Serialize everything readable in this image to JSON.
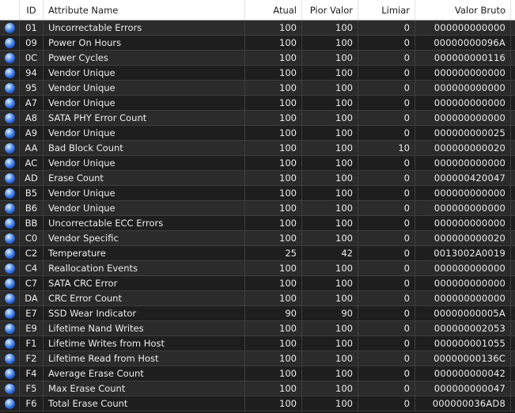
{
  "headers": {
    "id": "ID",
    "name": "Attribute Name",
    "current": "Atual",
    "worst": "Pior Valor",
    "threshold": "Limiar",
    "raw": "Valor Bruto"
  },
  "status_color": "#3a78e0",
  "rows": [
    {
      "id": "01",
      "name": "Uncorrectable Errors",
      "current": "100",
      "worst": "100",
      "threshold": "0",
      "raw": "000000000000"
    },
    {
      "id": "09",
      "name": "Power On Hours",
      "current": "100",
      "worst": "100",
      "threshold": "0",
      "raw": "00000000096A"
    },
    {
      "id": "0C",
      "name": "Power Cycles",
      "current": "100",
      "worst": "100",
      "threshold": "0",
      "raw": "000000000116"
    },
    {
      "id": "94",
      "name": "Vendor Unique",
      "current": "100",
      "worst": "100",
      "threshold": "0",
      "raw": "000000000000"
    },
    {
      "id": "95",
      "name": "Vendor Unique",
      "current": "100",
      "worst": "100",
      "threshold": "0",
      "raw": "000000000000"
    },
    {
      "id": "A7",
      "name": "Vendor Unique",
      "current": "100",
      "worst": "100",
      "threshold": "0",
      "raw": "000000000000"
    },
    {
      "id": "A8",
      "name": "SATA PHY Error Count",
      "current": "100",
      "worst": "100",
      "threshold": "0",
      "raw": "000000000000"
    },
    {
      "id": "A9",
      "name": "Vendor Unique",
      "current": "100",
      "worst": "100",
      "threshold": "0",
      "raw": "000000000025"
    },
    {
      "id": "AA",
      "name": "Bad Block Count",
      "current": "100",
      "worst": "100",
      "threshold": "10",
      "raw": "000000000020"
    },
    {
      "id": "AC",
      "name": "Vendor Unique",
      "current": "100",
      "worst": "100",
      "threshold": "0",
      "raw": "000000000000"
    },
    {
      "id": "AD",
      "name": "Erase Count",
      "current": "100",
      "worst": "100",
      "threshold": "0",
      "raw": "000000420047"
    },
    {
      "id": "B5",
      "name": "Vendor Unique",
      "current": "100",
      "worst": "100",
      "threshold": "0",
      "raw": "000000000000"
    },
    {
      "id": "B6",
      "name": "Vendor Unique",
      "current": "100",
      "worst": "100",
      "threshold": "0",
      "raw": "000000000000"
    },
    {
      "id": "BB",
      "name": "Uncorrectable ECC Errors",
      "current": "100",
      "worst": "100",
      "threshold": "0",
      "raw": "000000000000"
    },
    {
      "id": "C0",
      "name": "Vendor Specific",
      "current": "100",
      "worst": "100",
      "threshold": "0",
      "raw": "000000000020"
    },
    {
      "id": "C2",
      "name": "Temperature",
      "current": "25",
      "worst": "42",
      "threshold": "0",
      "raw": "0013002A0019"
    },
    {
      "id": "C4",
      "name": "Reallocation Events",
      "current": "100",
      "worst": "100",
      "threshold": "0",
      "raw": "000000000000"
    },
    {
      "id": "C7",
      "name": "SATA CRC Error",
      "current": "100",
      "worst": "100",
      "threshold": "0",
      "raw": "000000000000"
    },
    {
      "id": "DA",
      "name": "CRC Error Count",
      "current": "100",
      "worst": "100",
      "threshold": "0",
      "raw": "000000000000"
    },
    {
      "id": "E7",
      "name": "SSD Wear Indicator",
      "current": "90",
      "worst": "90",
      "threshold": "0",
      "raw": "00000000005A"
    },
    {
      "id": "E9",
      "name": "Lifetime Nand Writes",
      "current": "100",
      "worst": "100",
      "threshold": "0",
      "raw": "000000002053"
    },
    {
      "id": "F1",
      "name": "Lifetime Writes from Host",
      "current": "100",
      "worst": "100",
      "threshold": "0",
      "raw": "000000001055"
    },
    {
      "id": "F2",
      "name": "Lifetime Read from Host",
      "current": "100",
      "worst": "100",
      "threshold": "0",
      "raw": "00000000136C"
    },
    {
      "id": "F4",
      "name": "Average Erase Count",
      "current": "100",
      "worst": "100",
      "threshold": "0",
      "raw": "000000000042"
    },
    {
      "id": "F5",
      "name": "Max Erase Count",
      "current": "100",
      "worst": "100",
      "threshold": "0",
      "raw": "000000000047"
    },
    {
      "id": "F6",
      "name": "Total Erase Count",
      "current": "100",
      "worst": "100",
      "threshold": "0",
      "raw": "000000036AD8"
    }
  ]
}
